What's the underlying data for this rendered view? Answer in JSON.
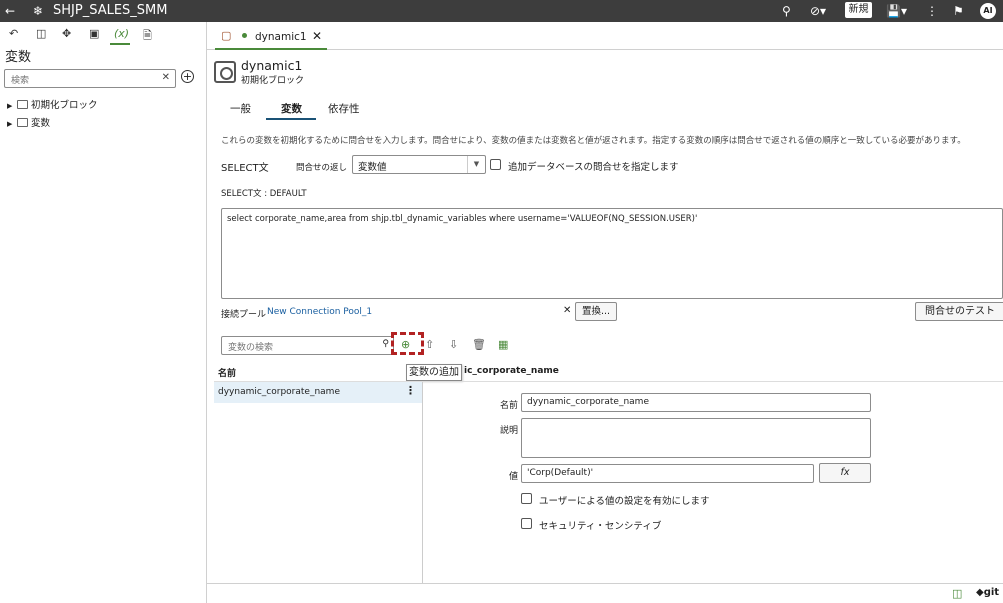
{
  "app": {
    "title": "SHJP_SALES_SMM",
    "new_label": "新規",
    "avatar": "AI"
  },
  "left": {
    "title": "変数",
    "search_placeholder": "検索",
    "tree": [
      {
        "label": "初期化ブロック"
      },
      {
        "label": "変数"
      }
    ]
  },
  "tab": {
    "label": "dynamic1"
  },
  "header": {
    "name": "dynamic1",
    "type": "初期化ブロック"
  },
  "subtabs": {
    "general": "一般",
    "variables": "変数",
    "dependencies": "依存性"
  },
  "description": "これらの変数を初期化するために問合せを入力します。問合せにより、変数の値または変数名と値が返されます。指定する変数の順序は問合せで返される値の順序と一致している必要があります。",
  "select": {
    "label": "SELECT文",
    "return_label": "問合せの返し",
    "return_value": "変数値",
    "checkbox_label": "追加データベースの問合せを指定します",
    "default_label": "SELECT文 : DEFAULT",
    "query": "select corporate_name,area from shjp.tbl_dynamic_variables where username='VALUEOF(NQ_SESSION.USER)'"
  },
  "pool": {
    "label": "接続プール",
    "value": "New Connection Pool_1",
    "replace": "置換...",
    "test": "問合せのテスト"
  },
  "vars": {
    "search_placeholder": "変数の検索",
    "tooltip": "変数の追加",
    "col_name": "名前",
    "rows": [
      {
        "name": "dyynamic_corporate_name"
      }
    ]
  },
  "detail": {
    "header": "dyynamic_corporate_name",
    "name_label": "名前",
    "name_value": "dyynamic_corporate_name",
    "desc_label": "説明",
    "value_label": "値",
    "value_value": "'Corp(Default)'",
    "fx": "fx",
    "chk1": "ユーザーによる値の設定を有効にします",
    "chk2": "セキュリティ・センシティブ"
  },
  "bottom": {
    "git": "git"
  },
  "colors": {
    "topbar": "#3d3d3d",
    "accent": "#4a8a3a",
    "link": "#1a5fa0",
    "highlight": "#b22222"
  }
}
